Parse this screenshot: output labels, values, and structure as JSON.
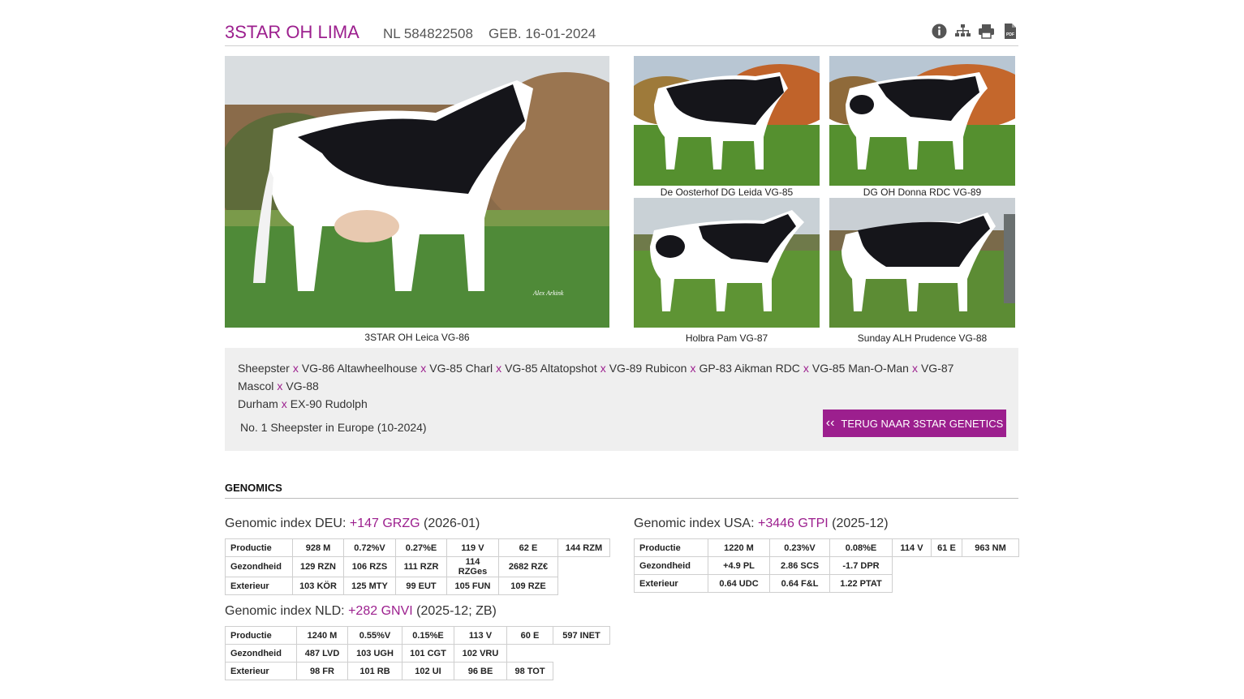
{
  "header": {
    "name": "3STAR OH LIMA",
    "registration": "NL 584822508",
    "birth": "GEB. 16-01-2024",
    "icons": [
      "info-icon",
      "pedigree-tree-icon",
      "print-icon",
      "pdf-icon"
    ],
    "pdf_label": "PDF"
  },
  "photos": {
    "main": {
      "caption": "3STAR OH Leica VG-86",
      "watermark": "Alex Arkink"
    },
    "grid": [
      {
        "caption": "De Oosterhof DG Leida VG-85"
      },
      {
        "caption": "DG OH Donna RDC VG-89"
      },
      {
        "caption": "Holbra Pam VG-87"
      },
      {
        "caption": "Sunday ALH Prudence VG-88"
      }
    ]
  },
  "pedigree": {
    "separator": "x",
    "line1": [
      "Sheepster",
      "VG-86 Altawheelhouse",
      "VG-85 Charl",
      "VG-85 Altatopshot",
      "VG-89 Rubicon",
      "GP-83 Aikman RDC",
      "VG-85 Man-O-Man",
      "VG-87 Mascol",
      "VG-88"
    ],
    "line2": [
      "Durham",
      "EX-90 Rudolph"
    ],
    "remark": "No. 1 Sheepster in Europe (10-2024)",
    "back_label": "TERUG NAAR 3STAR GENETICS",
    "back_icon": "‹‹"
  },
  "genomics": {
    "title": "GENOMICS",
    "deu": {
      "prefix": "Genomic index DEU:",
      "value": "+147 GRZG",
      "suffix": "(2026-01)",
      "rows": [
        [
          "Productie",
          "928 M",
          "0.72%V",
          "0.27%E",
          "119 V",
          "62 E",
          "144 RZM"
        ],
        [
          "Gezondheid",
          "129 RZN",
          "106 RZS",
          "111 RZR",
          "114 RZGes",
          "2682 RZ€"
        ],
        [
          "Exterieur",
          "103 KÖR",
          "125 MTY",
          "99 EUT",
          "105 FUN",
          "109 RZE"
        ]
      ]
    },
    "usa": {
      "prefix": "Genomic index USA:",
      "value": "+3446 GTPI",
      "suffix": "(2025-12)",
      "rows": [
        [
          "Productie",
          "1220 M",
          "0.23%V",
          "0.08%E",
          "114 V",
          "61 E",
          "963 NM"
        ],
        [
          "Gezondheid",
          "+4.9 PL",
          "2.86 SCS",
          "-1.7 DPR"
        ],
        [
          "Exterieur",
          "0.64 UDC",
          "0.64 F&L",
          "1.22 PTAT"
        ]
      ]
    },
    "nld": {
      "prefix": "Genomic index NLD:",
      "value": "+282 GNVI",
      "suffix": "(2025-12; ZB)",
      "rows": [
        [
          "Productie",
          "1240 M",
          "0.55%V",
          "0.15%E",
          "113 V",
          "60 E",
          "597 INET"
        ],
        [
          "Gezondheid",
          "487 LVD",
          "103 UGH",
          "101 CGT",
          "102 VRU"
        ],
        [
          "Exterieur",
          "98 FR",
          "101 RB",
          "102 UI",
          "96 BE",
          "98 TOT"
        ]
      ]
    }
  },
  "colors": {
    "accent": "#9c1f8e",
    "box_bg": "#efefef"
  }
}
